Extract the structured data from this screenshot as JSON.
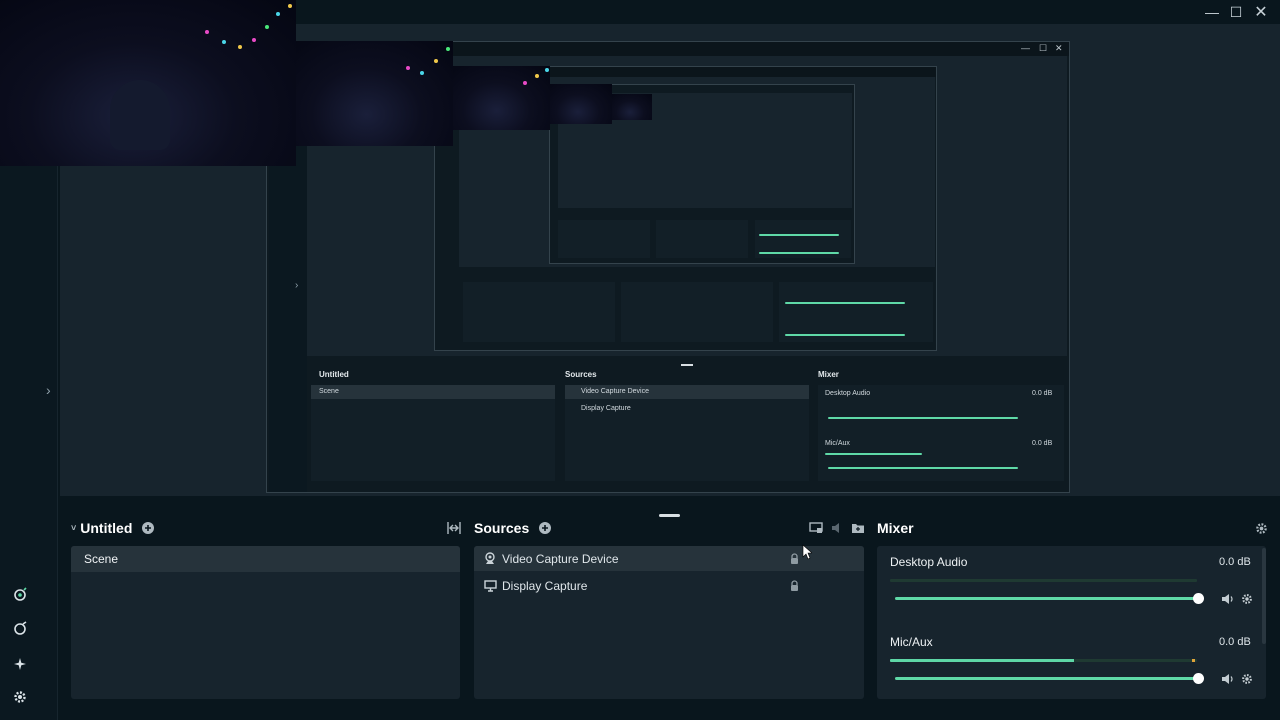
{
  "window": {
    "minimize_icon": "—",
    "maximize_icon": "☐",
    "close_icon": "✕"
  },
  "preview": {
    "expand_arrow": "›",
    "nested": {
      "scenes_title": "Untitled",
      "scene_label": "Scene",
      "sources_title": "Sources",
      "source1": "Video Capture Device",
      "source2": "Display Capture",
      "mixer_title": "Mixer",
      "desktop_audio": "Desktop Audio",
      "mic_aux": "Mic/Aux",
      "db_value": "0.0 dB"
    }
  },
  "scenes": {
    "title": "Untitled",
    "items": [
      {
        "label": "Scene"
      }
    ]
  },
  "sources": {
    "title": "Sources",
    "items": [
      {
        "label": "Video Capture Device",
        "icon": "webcam-icon"
      },
      {
        "label": "Display Capture",
        "icon": "monitor-icon"
      }
    ]
  },
  "mixer": {
    "title": "Mixer",
    "channels": [
      {
        "name": "Desktop Audio",
        "db": "0.0 dB",
        "level": 0.0,
        "volume": 1.0
      },
      {
        "name": "Mic/Aux",
        "db": "0.0 dB",
        "level": 0.6,
        "volume": 1.0
      }
    ]
  },
  "colors": {
    "accent": "#5fd9a7",
    "background": "#09161d",
    "panel": "#17242d"
  }
}
